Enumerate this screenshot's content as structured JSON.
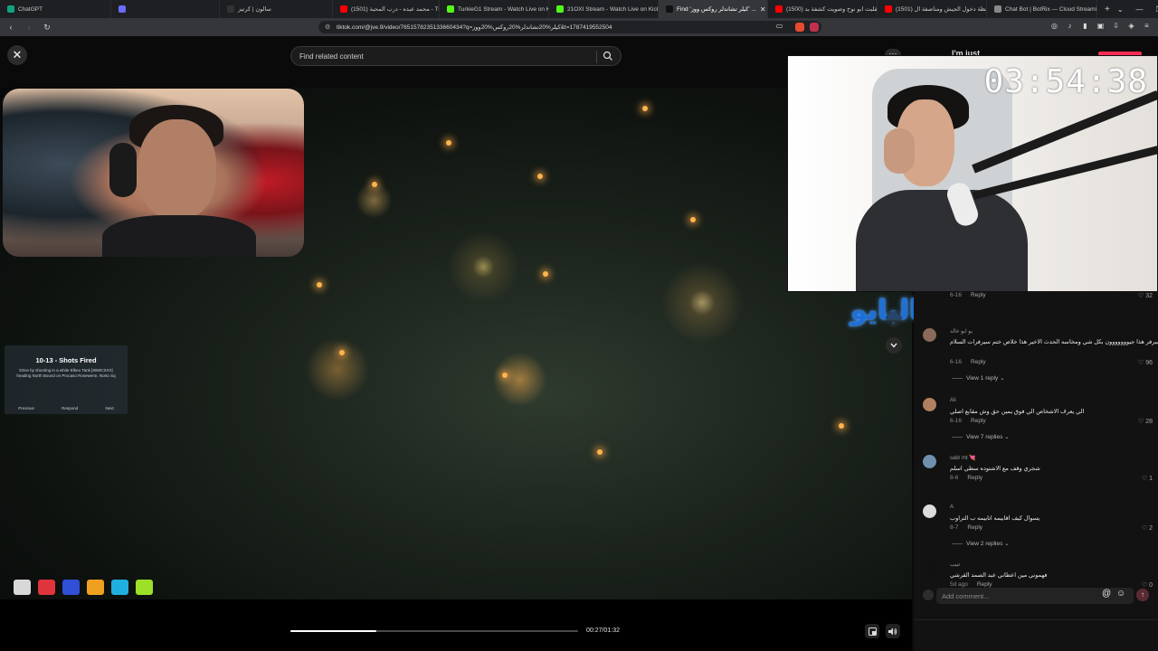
{
  "browser": {
    "tabs": [
      {
        "label": "ChatGPT",
        "fav": "#10a37f",
        "active": false
      },
      {
        "label": "",
        "fav": "#6b6bff",
        "active": false
      },
      {
        "label": "سالون | كرتيز",
        "fav": "#333",
        "active": false
      },
      {
        "label": "(1501) محمد عبده - درب المحبة - Tube",
        "fav": "#ff0000",
        "active": false
      },
      {
        "label": "TurkieG1 Stream - Watch Live on Kick",
        "fav": "#53fc18",
        "active": false
      },
      {
        "label": "21OXI Stream - Watch Live on Kick",
        "fav": "#53fc18",
        "active": false
      },
      {
        "label": "Find 'كيلر تشاندلر روكس ووز' ...",
        "fav": "#111",
        "active": true
      },
      {
        "label": "(1500) مقلبت ابو نوح وصويت كشفة بد...",
        "fav": "#ff0000",
        "active": false
      },
      {
        "label": "(1501) لحظة دخول الجيش ومناصفة ال...",
        "fav": "#ff0000",
        "active": false
      },
      {
        "label": "Chat Bot | BotRix — Cloud Streaming...",
        "fav": "#888",
        "active": false
      }
    ],
    "new_tab": "+",
    "window_controls": [
      "⌄",
      "—",
      "❐",
      "✕"
    ],
    "url": "tiktok.com/@jve.9/video/7651578235133660434?q=كيلر%20تشاندلر%20روكس%20ووز&t=1787419552504"
  },
  "page": {
    "search_placeholder": "Find related content",
    "account_name": "I'm just",
    "donate_overlay": "رابط الدعم بالبايو",
    "timer": "03:54:38",
    "game_panel": {
      "header": "",
      "title": "10-13 - Shots Fired",
      "body": "Drive by shooting in a white Elbeo Tank [90MCSXX] heading North Bound on Procaso Rosewenn. Norto Sq",
      "actions": [
        "Previous",
        "Respond",
        "Next"
      ]
    },
    "hud_icon_colors": [
      "#d8d8d8",
      "#e0343c",
      "#3050d8",
      "#f0a020",
      "#20b0e0",
      "#9ce028"
    ],
    "progress": 0.3,
    "time": "00:27/01:32"
  },
  "comments": [
    {
      "user": "",
      "text": "",
      "date": "6-16",
      "reply": "Reply",
      "likes": "32",
      "avatar": "#444"
    },
    {
      "user": "بو ابو خالد",
      "text": "هالسيرفر هذا جيووووووون بكل شي ومخاسه الحدث الاخير هذا خلاص ختم سيرفرات السلام",
      "date": "6-16",
      "reply": "Reply",
      "likes": "96",
      "avatar": "#8a6a5a",
      "replies": "View 1 reply"
    },
    {
      "user": "Ali",
      "text": "الي يعرف الاشخاص الي فوق يمين حق وش مقابع اصلي",
      "date": "6-16",
      "reply": "Reply",
      "likes": "28",
      "avatar": "#b08060",
      "replies": "View 7 replies"
    },
    {
      "user": "sab/ mt 💘",
      "text": "شجري وقف مع الاشتوده سطي اسلم",
      "date": "8-6",
      "reply": "Reply",
      "likes": "1",
      "avatar": "#7090b0"
    },
    {
      "user": "A",
      "text": "يسوال كيف اقابيمه اتابيمه ب التراوب",
      "date": "8-7",
      "reply": "Reply",
      "likes": "2",
      "avatar": "#dcdcdc",
      "replies": "View 2 replies"
    },
    {
      "user": "تنيب",
      "text": "فهموني مين اعطاني عبد الصمد القرشي",
      "date": "5d ago",
      "reply": "Reply",
      "likes": "0",
      "avatar": "#111"
    }
  ],
  "comment_input": {
    "placeholder": "Add comment..."
  }
}
